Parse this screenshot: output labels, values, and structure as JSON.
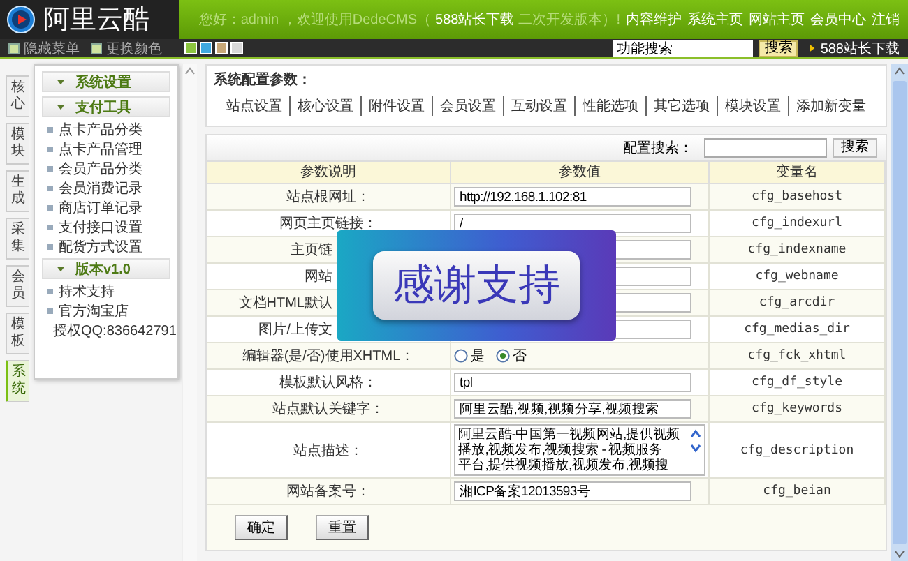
{
  "header": {
    "logo_text": "阿里云酷",
    "greeting": "您好：admin ，欢迎使用DedeCMS（",
    "greeting_link": "588站长下载",
    "greeting_tail": "二次开发版本）!",
    "links": [
      "内容维护",
      "系统主页",
      "网站主页",
      "会员中心",
      "注销"
    ]
  },
  "toolbar": {
    "buttons": [
      "隐藏菜单",
      "更换颜色"
    ],
    "swatches": [
      {
        "color": "#8cc63f"
      },
      {
        "color": "#3fa9e0"
      },
      {
        "color": "#c8a878"
      },
      {
        "color": "#d8d8d8"
      }
    ],
    "search_value": "功能搜索",
    "search_button": "搜索",
    "download_link": "588站长下载"
  },
  "side_tabs": [
    {
      "label": "核心",
      "selected": false
    },
    {
      "label": "模块",
      "selected": false
    },
    {
      "label": "生成",
      "selected": false
    },
    {
      "label": "采集",
      "selected": false
    },
    {
      "label": "会员",
      "selected": false
    },
    {
      "label": "模板",
      "selected": false
    },
    {
      "label": "系统",
      "selected": true
    }
  ],
  "menu": [
    {
      "title": "系统设置"
    },
    {
      "title": "支付工具",
      "items": [
        "点卡产品分类",
        "点卡产品管理",
        "会员产品分类",
        "会员消费记录",
        "商店订单记录",
        "支付接口设置",
        "配货方式设置"
      ]
    },
    {
      "title": "版本v1.0",
      "items": [
        "持术支持",
        "官方淘宝店",
        "授权QQ:836642791"
      ]
    }
  ],
  "panel": {
    "title": "系统配置参数：",
    "links": [
      "站点设置",
      "核心设置",
      "附件设置",
      "会员设置",
      "互动设置",
      "性能选项",
      "其它选项",
      "模块设置",
      "添加新变量"
    ]
  },
  "table": {
    "search_label": "配置搜索：",
    "search_button": "搜索",
    "columns": [
      "参数说明",
      "参数值",
      "变量名"
    ],
    "rows": [
      {
        "kind": "text",
        "label": "站点根网址：",
        "value": "http://192.168.1.102:81",
        "variable": "cfg_basehost"
      },
      {
        "kind": "text",
        "label": "网页主页链接：",
        "value": "/",
        "variable": "cfg_indexurl"
      },
      {
        "kind": "text",
        "label": "主页链",
        "obscured": true,
        "variable": "cfg_indexname"
      },
      {
        "kind": "text",
        "label": "网站",
        "obscured": true,
        "variable": "cfg_webname"
      },
      {
        "kind": "text",
        "label": "文档HTML默认",
        "obscured": true,
        "variable": "cfg_arcdir"
      },
      {
        "kind": "text",
        "label": "图片/上传文",
        "obscured": true,
        "variable": "cfg_medias_dir"
      },
      {
        "kind": "radio",
        "label": "编辑器(是/否)使用XHTML：",
        "options": [
          {
            "label": "是",
            "selected": false
          },
          {
            "label": "否",
            "selected": true
          }
        ],
        "variable": "cfg_fck_xhtml"
      },
      {
        "kind": "text",
        "label": "模板默认风格：",
        "value": "tpl",
        "variable": "cfg_df_style"
      },
      {
        "kind": "text",
        "label": "站点默认关键字：",
        "value": "阿里云酷,视频,视频分享,视频搜索",
        "variable": "cfg_keywords"
      },
      {
        "kind": "textarea",
        "label": "站点描述：",
        "lines": [
          "阿里云酷-中国第一视频网站,提供视频",
          "播放,视频发布,视频搜索 - 视频服务",
          "平台,提供视频播放,视频发布,视频搜"
        ],
        "variable": "cfg_description"
      },
      {
        "kind": "text",
        "label": "网站备案号：",
        "value": "湘ICP备案12013593号",
        "variable": "cfg_beian"
      }
    ],
    "buttons": [
      "确定",
      "重置"
    ]
  },
  "overlay": {
    "text": "感谢支持"
  }
}
